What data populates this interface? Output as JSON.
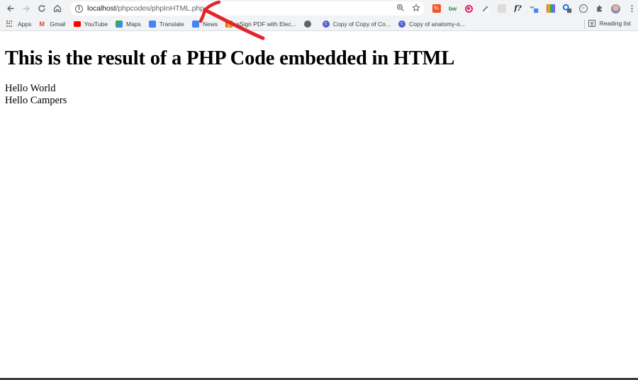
{
  "browser": {
    "url_host": "localhost",
    "url_path": "/phpcodes/phpInHTML.php",
    "nav": {
      "back": "back",
      "forward": "forward",
      "reload": "reload",
      "home": "home"
    },
    "omnibox_icons": [
      "zoom-icon",
      "bookmark-star-icon"
    ],
    "extensions": [
      {
        "name": "extension-orange",
        "label": "%",
        "color": "#f4511e"
      },
      {
        "name": "extension-bw",
        "label": "bw",
        "color": "#1e8e3e"
      },
      {
        "name": "extension-pink-circle",
        "label": "◉",
        "color": "#e91e63"
      },
      {
        "name": "extension-eyedropper",
        "label": "",
        "color": "#5f6368"
      },
      {
        "name": "extension-grey",
        "label": "",
        "color": "#c4c4c4"
      },
      {
        "name": "extension-fonts",
        "label": "f?",
        "color": "#202124"
      },
      {
        "name": "extension-green-x",
        "label": "",
        "color": "#34a853"
      },
      {
        "name": "extension-rainbow",
        "label": "",
        "color": "#fbbc04"
      },
      {
        "name": "extension-blue-ring",
        "label": "",
        "color": "#1a73e8"
      },
      {
        "name": "extension-code",
        "label": "‹›",
        "color": "#5f6368"
      },
      {
        "name": "extensions-puzzle",
        "label": "",
        "color": "#5f6368"
      },
      {
        "name": "profile-avatar",
        "label": "",
        "color": "#7a8fb0"
      },
      {
        "name": "menu-kebab",
        "label": "⋮",
        "color": "#5f6368"
      }
    ]
  },
  "bookmarks": {
    "items": [
      {
        "label": "Apps",
        "icon": "apps-grid-icon"
      },
      {
        "label": "Gmail",
        "icon": "gmail-icon",
        "color": "#ea4335"
      },
      {
        "label": "YouTube",
        "icon": "youtube-icon",
        "color": "#ff0000"
      },
      {
        "label": "Maps",
        "icon": "maps-icon",
        "color": "#34a853"
      },
      {
        "label": "Translate",
        "icon": "translate-icon",
        "color": "#4285f4"
      },
      {
        "label": "News",
        "icon": "news-icon",
        "color": "#4285f4"
      },
      {
        "label": "eSign PDF with Elec...",
        "icon": "esign-icon",
        "color": "#fbbc04"
      },
      {
        "label": "",
        "icon": "globe-icon",
        "color": "#5f6368"
      },
      {
        "label": "Copy of Copy of Co...",
        "icon": "doc-c-icon",
        "color": "#4a5fd1"
      },
      {
        "label": "Copy of anatomy-o...",
        "icon": "doc-c-icon",
        "color": "#4a5fd1"
      }
    ],
    "reading_list": "Reading list"
  },
  "page": {
    "heading": "This is the result of a PHP Code embedded in HTML",
    "lines": [
      "Hello World",
      "Hello Campers"
    ]
  },
  "annotation": {
    "type": "hand-drawn-arrow",
    "color": "#e3242b",
    "points_to": "url"
  }
}
